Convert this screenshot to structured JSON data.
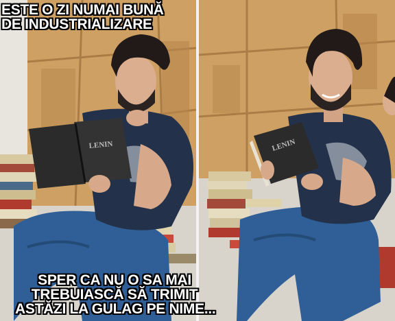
{
  "captions": {
    "top": [
      "ESTE O ZI NUMAI BUNĂ",
      "DE INDUSTRIALIZARE"
    ],
    "bottom": [
      "SPER CA NU O SA MAI",
      "TREBUIASCĂ SĂ TRIMIT",
      "ASTĂZI LA GULAG PE NIME..."
    ]
  },
  "book": {
    "cover_text": "LENIN"
  },
  "colors": {
    "door": "#c89a5e",
    "door_dark": "#9c6f3a",
    "shirt": "#23324a",
    "jeans": "#2f5f96",
    "book": "#2b2b2b",
    "floor": "#d9d6cf"
  }
}
